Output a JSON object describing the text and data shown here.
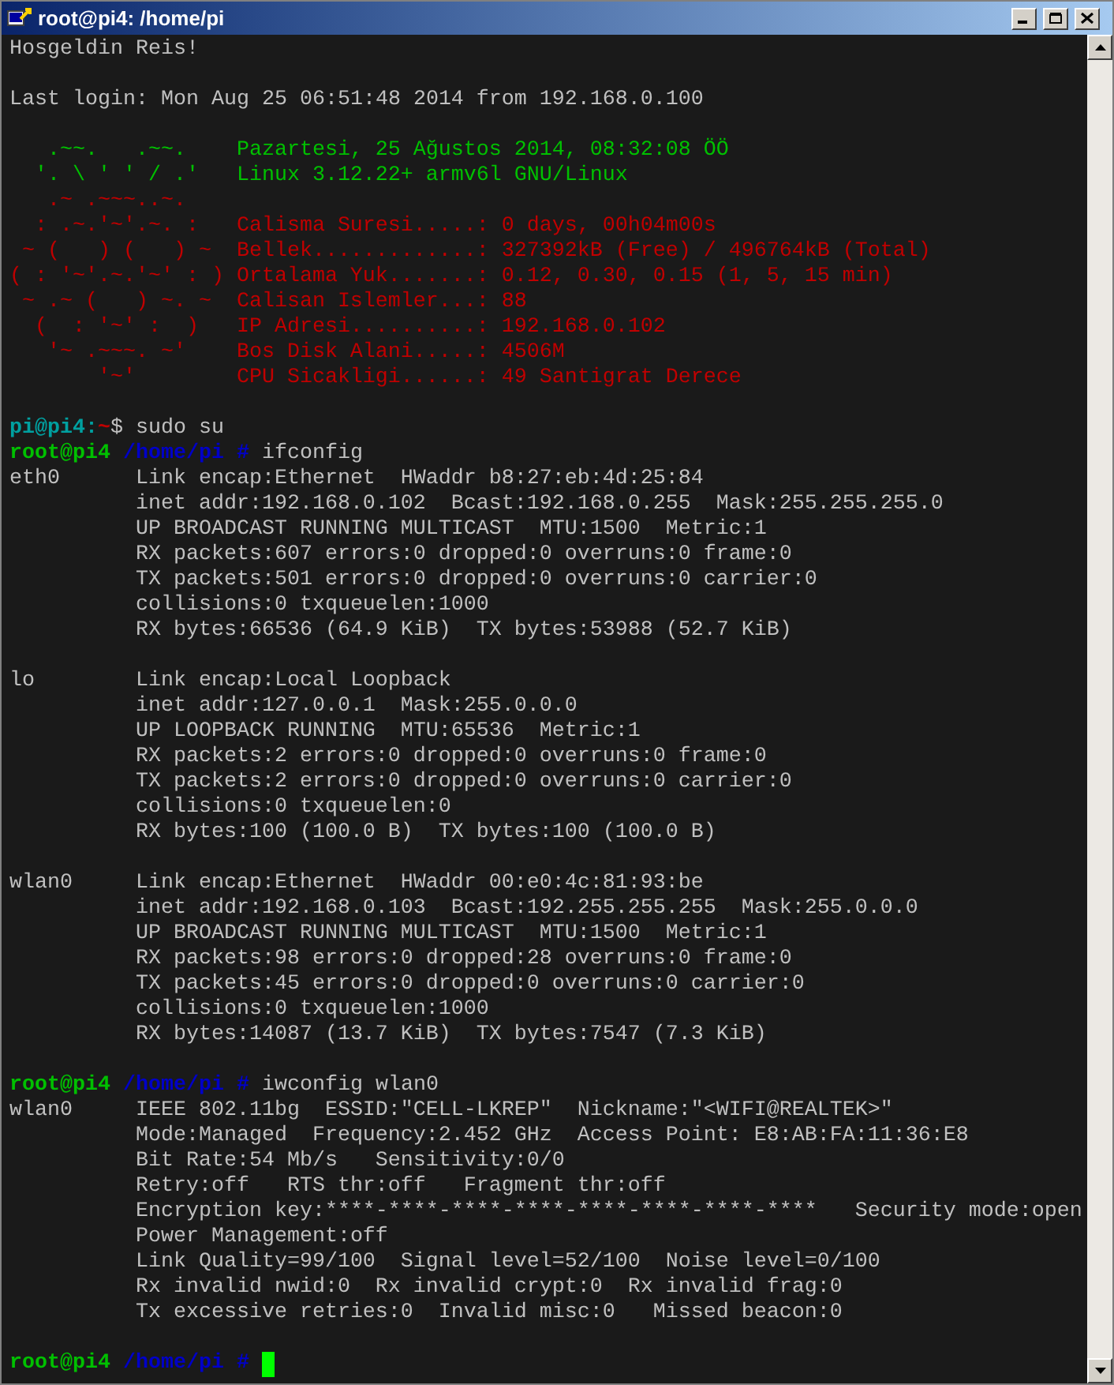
{
  "window": {
    "title": "root@pi4: /home/pi"
  },
  "lines": [
    {
      "kind": "output",
      "text": "Hosgeldin Reis!"
    },
    {
      "kind": "blank"
    },
    {
      "kind": "output",
      "text": "Last login: Mon Aug 25 06:51:48 2014 from 192.168.0.100"
    },
    {
      "kind": "blank"
    },
    {
      "kind": "motd",
      "art": "   .~~.   .~~.",
      "info": "Pazartesi, 25 Ağustos 2014, 08:32:08 ÖÖ",
      "color": "#00c000"
    },
    {
      "kind": "motd",
      "art": "  '. \\ ' ' / .'",
      "info": "Linux 3.12.22+ armv6l GNU/Linux",
      "color": "#00c000"
    },
    {
      "kind": "motd",
      "art": "   .~ .~~~..~.",
      "color": "#c00000"
    },
    {
      "kind": "motd",
      "art": "  : .~.'~'.~. :",
      "info": "Calisma Suresi.....: 0 days, 00h04m00s",
      "color": "#c00000"
    },
    {
      "kind": "motd",
      "art": " ~ (   ) (   ) ~",
      "info": "Bellek.............: 327392kB (Free) / 496764kB (Total)",
      "color": "#c00000"
    },
    {
      "kind": "motd",
      "art": "( : '~'.~.'~' : )",
      "info": "Ortalama Yuk.......: 0.12, 0.30, 0.15 (1, 5, 15 min)",
      "color": "#c00000"
    },
    {
      "kind": "motd",
      "art": " ~ .~ (   ) ~. ~",
      "info": "Calisan Islemler...: 88",
      "color": "#c00000"
    },
    {
      "kind": "motd",
      "art": "  (  : '~' :  )",
      "info": "IP Adresi..........: 192.168.0.102",
      "color": "#c00000"
    },
    {
      "kind": "motd",
      "art": "   '~ .~~~. ~'",
      "info": "Bos Disk Alani.....: 4506M",
      "color": "#c00000"
    },
    {
      "kind": "motd",
      "art": "       '~'",
      "info": "CPU Sicakligi......: 49 Santigrat Derece",
      "color": "#c00000"
    },
    {
      "kind": "blank"
    },
    {
      "kind": "prompt",
      "segments": [
        {
          "text": "pi@pi4:",
          "color": "#00a0a0",
          "bold": true
        },
        {
          "text": "~",
          "color": "#c00000",
          "bold": true
        },
        {
          "text": "$ sudo su",
          "color": "#c0c0c0",
          "bold": false
        }
      ]
    },
    {
      "kind": "prompt",
      "segments": [
        {
          "text": "root@pi4",
          "color": "#00c000",
          "bold": true
        },
        {
          "text": " /home/pi #",
          "color": "#0000c8",
          "bold": true
        },
        {
          "text": " ifconfig",
          "color": "#c0c0c0",
          "bold": false
        }
      ]
    },
    {
      "kind": "output",
      "iface": "eth0",
      "text": "Link encap:Ethernet  HWaddr b8:27:eb:4d:25:84"
    },
    {
      "kind": "output",
      "iface_pad": true,
      "text": "inet addr:192.168.0.102  Bcast:192.168.0.255  Mask:255.255.255.0"
    },
    {
      "kind": "output",
      "iface_pad": true,
      "text": "UP BROADCAST RUNNING MULTICAST  MTU:1500  Metric:1"
    },
    {
      "kind": "output",
      "iface_pad": true,
      "text": "RX packets:607 errors:0 dropped:0 overruns:0 frame:0"
    },
    {
      "kind": "output",
      "iface_pad": true,
      "text": "TX packets:501 errors:0 dropped:0 overruns:0 carrier:0"
    },
    {
      "kind": "output",
      "iface_pad": true,
      "text": "collisions:0 txqueuelen:1000"
    },
    {
      "kind": "output",
      "iface_pad": true,
      "text": "RX bytes:66536 (64.9 KiB)  TX bytes:53988 (52.7 KiB)"
    },
    {
      "kind": "blank"
    },
    {
      "kind": "output",
      "iface": "lo",
      "text": "Link encap:Local Loopback"
    },
    {
      "kind": "output",
      "iface_pad": true,
      "text": "inet addr:127.0.0.1  Mask:255.0.0.0"
    },
    {
      "kind": "output",
      "iface_pad": true,
      "text": "UP LOOPBACK RUNNING  MTU:65536  Metric:1"
    },
    {
      "kind": "output",
      "iface_pad": true,
      "text": "RX packets:2 errors:0 dropped:0 overruns:0 frame:0"
    },
    {
      "kind": "output",
      "iface_pad": true,
      "text": "TX packets:2 errors:0 dropped:0 overruns:0 carrier:0"
    },
    {
      "kind": "output",
      "iface_pad": true,
      "text": "collisions:0 txqueuelen:0"
    },
    {
      "kind": "output",
      "iface_pad": true,
      "text": "RX bytes:100 (100.0 B)  TX bytes:100 (100.0 B)"
    },
    {
      "kind": "blank"
    },
    {
      "kind": "output",
      "iface": "wlan0",
      "text": "Link encap:Ethernet  HWaddr 00:e0:4c:81:93:be"
    },
    {
      "kind": "output",
      "iface_pad": true,
      "text": "inet addr:192.168.0.103  Bcast:192.255.255.255  Mask:255.0.0.0"
    },
    {
      "kind": "output",
      "iface_pad": true,
      "text": "UP BROADCAST RUNNING MULTICAST  MTU:1500  Metric:1"
    },
    {
      "kind": "output",
      "iface_pad": true,
      "text": "RX packets:98 errors:0 dropped:28 overruns:0 frame:0"
    },
    {
      "kind": "output",
      "iface_pad": true,
      "text": "TX packets:45 errors:0 dropped:0 overruns:0 carrier:0"
    },
    {
      "kind": "output",
      "iface_pad": true,
      "text": "collisions:0 txqueuelen:1000"
    },
    {
      "kind": "output",
      "iface_pad": true,
      "text": "RX bytes:14087 (13.7 KiB)  TX bytes:7547 (7.3 KiB)"
    },
    {
      "kind": "blank"
    },
    {
      "kind": "prompt",
      "segments": [
        {
          "text": "root@pi4",
          "color": "#00c000",
          "bold": true
        },
        {
          "text": " /home/pi #",
          "color": "#0000c8",
          "bold": true
        },
        {
          "text": " iwconfig wlan0",
          "color": "#c0c0c0",
          "bold": false
        }
      ]
    },
    {
      "kind": "output",
      "iface": "wlan0",
      "text": "IEEE 802.11bg  ESSID:\"CELL-LKREP\"  Nickname:\"<WIFI@REALTEK>\""
    },
    {
      "kind": "output",
      "iface_pad": true,
      "text": "Mode:Managed  Frequency:2.452 GHz  Access Point: E8:AB:FA:11:36:E8"
    },
    {
      "kind": "output",
      "iface_pad": true,
      "text": "Bit Rate:54 Mb/s   Sensitivity:0/0"
    },
    {
      "kind": "output",
      "iface_pad": true,
      "text": "Retry:off   RTS thr:off   Fragment thr:off"
    },
    {
      "kind": "output",
      "iface_pad": true,
      "text": "Encryption key:****-****-****-****-****-****-****-****   Security mode:open"
    },
    {
      "kind": "output",
      "iface_pad": true,
      "text": "Power Management:off"
    },
    {
      "kind": "output",
      "iface_pad": true,
      "text": "Link Quality=99/100  Signal level=52/100  Noise level=0/100"
    },
    {
      "kind": "output",
      "iface_pad": true,
      "text": "Rx invalid nwid:0  Rx invalid crypt:0  Rx invalid frag:0"
    },
    {
      "kind": "output",
      "iface_pad": true,
      "text": "Tx excessive retries:0  Invalid misc:0   Missed beacon:0"
    },
    {
      "kind": "blank"
    },
    {
      "kind": "prompt",
      "cursor": true,
      "segments": [
        {
          "text": "root@pi4",
          "color": "#00c000",
          "bold": true
        },
        {
          "text": " /home/pi #",
          "color": "#0000c8",
          "bold": true
        }
      ]
    }
  ]
}
